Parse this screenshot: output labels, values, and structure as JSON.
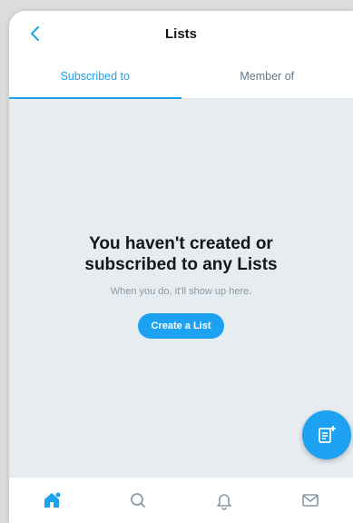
{
  "header": {
    "title": "Lists",
    "back_icon": "chevron-left-icon"
  },
  "tabs": [
    {
      "label": "Subscribed to",
      "active": true
    },
    {
      "label": "Member of",
      "active": false
    }
  ],
  "empty_state": {
    "heading": "You haven't created or\nsubscribed to any Lists",
    "subtext": "When you do, it'll show up here.",
    "button_label": "Create a List"
  },
  "fab": {
    "icon": "compose-list-icon"
  },
  "bottom_nav": [
    {
      "icon": "home-icon",
      "active": true
    },
    {
      "icon": "search-icon",
      "active": false
    },
    {
      "icon": "notifications-icon",
      "active": false
    },
    {
      "icon": "messages-icon",
      "active": false
    }
  ],
  "colors": {
    "accent": "#1da1f2",
    "background": "#e6ecf0",
    "text_primary": "#14171a",
    "text_secondary": "#657786"
  }
}
